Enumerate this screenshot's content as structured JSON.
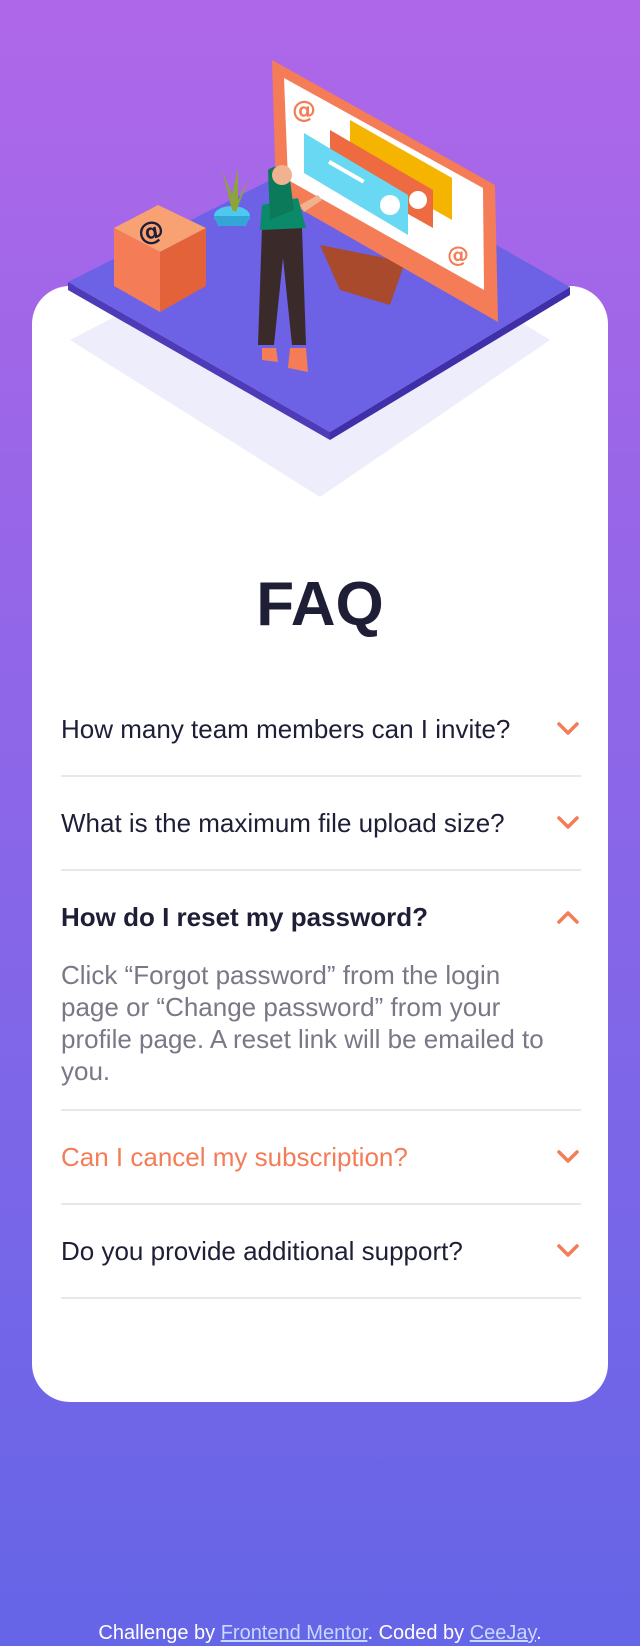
{
  "page": {
    "title": "FAQ",
    "accent_color": "#f47c57",
    "text_color": "#1e1f36",
    "muted_text_color": "#787887",
    "bg_gradient": [
      "#af67e9",
      "#6565e7"
    ]
  },
  "faq": [
    {
      "question": "How many team members can I invite?",
      "expanded": false,
      "state": "normal"
    },
    {
      "question": "What is the maximum file upload size?",
      "expanded": false,
      "state": "normal"
    },
    {
      "question": "How do I reset my password?",
      "expanded": true,
      "state": "active",
      "answer": "Click “Forgot password” from the login page or “Change password” from your profile page. A reset link will be emailed to you."
    },
    {
      "question": "Can I cancel my subscription?",
      "expanded": false,
      "state": "hover"
    },
    {
      "question": "Do you provide additional support?",
      "expanded": false,
      "state": "normal"
    }
  ],
  "footer": {
    "challenge_prefix": "Challenge by ",
    "challenge_link": "Frontend Mentor",
    "separator": ". ",
    "coded_prefix": " Coded by ",
    "coded_link": "CeeJay",
    "end": "."
  },
  "icons": {
    "chevron_down": "chevron-down-icon",
    "chevron_up": "chevron-up-icon",
    "illustration": "woman-online-illustration"
  }
}
